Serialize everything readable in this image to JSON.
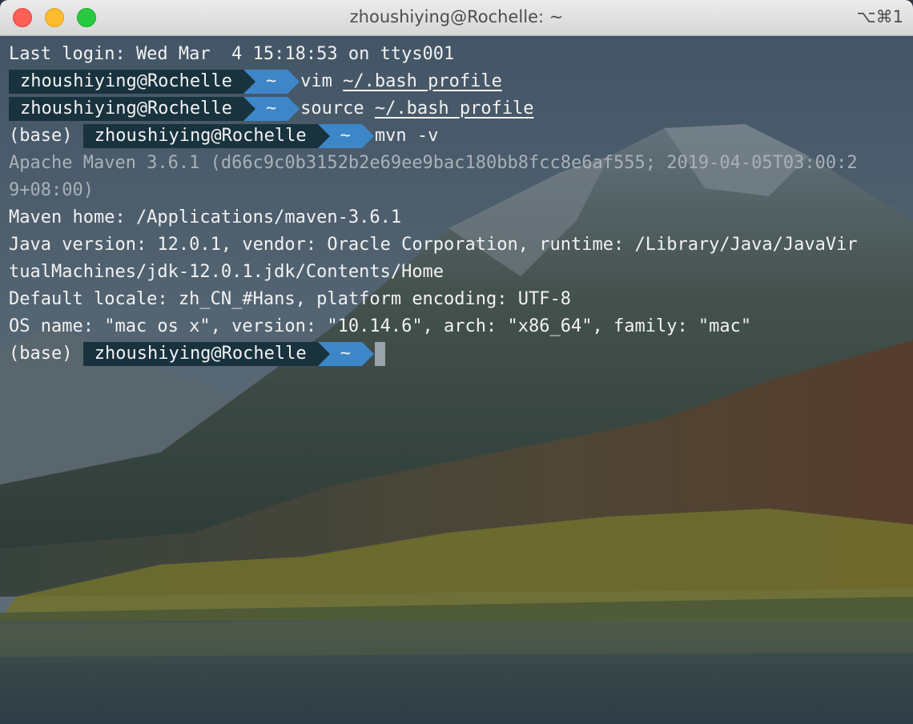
{
  "window": {
    "title": "zhoushiying@Rochelle: ~",
    "shortcut": "⌥⌘1"
  },
  "terminal": {
    "last_login": "Last login: Wed Mar  4 15:18:53 on ttys001",
    "prompt_user": "zhoushiying@Rochelle",
    "prompt_dir": "~",
    "conda_env": "(base)",
    "cmd1_verb": "vim ",
    "cmd1_arg": "~/.bash_profile",
    "cmd2_verb": "source ",
    "cmd2_arg": "~/.bash_profile",
    "cmd3": "mvn -v",
    "output": {
      "maven_version_line1": "Apache Maven 3.6.1 (d66c9c0b3152b2e69ee9bac180bb8fcc8e6af555; 2019-04-05T03:00:2",
      "maven_version_line2": "9+08:00)",
      "maven_home": "Maven home: /Applications/maven-3.6.1",
      "java_version_line1": "Java version: 12.0.1, vendor: Oracle Corporation, runtime: /Library/Java/JavaVir",
      "java_version_line2": "tualMachines/jdk-12.0.1.jdk/Contents/Home",
      "locale": "Default locale: zh_CN_#Hans, platform encoding: UTF-8",
      "os": "OS name: \"mac os x\", version: \"10.14.6\", arch: \"x86_64\", family: \"mac\""
    }
  },
  "colors": {
    "prompt_user_bg": "#18323e",
    "prompt_dir_bg": "#3d87c8",
    "text": "#f2f2f2",
    "dim_text": "#a9b1b8"
  },
  "icons": {
    "close": "traffic-light-close-icon",
    "minimize": "traffic-light-minimize-icon",
    "maximize": "traffic-light-maximize-icon"
  }
}
